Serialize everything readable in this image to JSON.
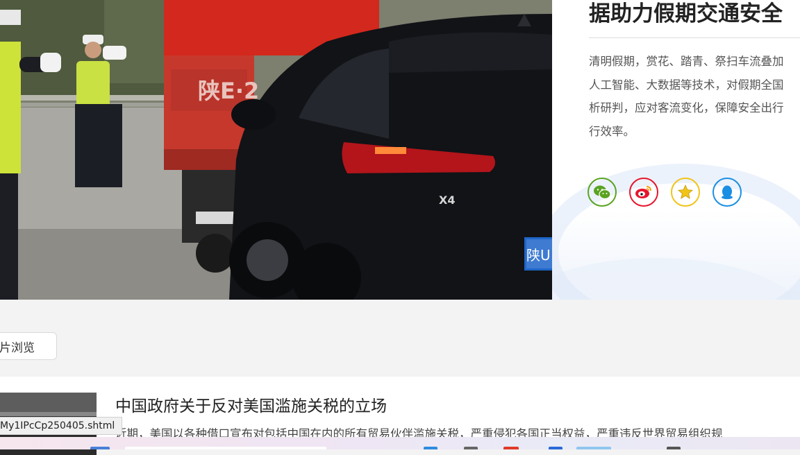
{
  "hero": {
    "photo_plate_text": "陕U",
    "photo_badge_text": "X4",
    "photo_truck_text": "陕E·2"
  },
  "side": {
    "title": "据助力假期交通安全",
    "body_lines": [
      "清明假期，赏花、踏青、祭扫车流叠加",
      "人工智能、大数据等技术，对假期全国",
      "析研判，应对客流变化，保障安全出行",
      "行效率。"
    ],
    "share_icons": [
      "wechat-icon",
      "weibo-icon",
      "favorite-star-icon",
      "qq-icon"
    ],
    "colors": {
      "wechat": "#5aa322",
      "weibo": "#e6162d",
      "favorite": "#f0c419",
      "qq": "#1a8fe3"
    }
  },
  "toolbar": {
    "browse_label": "片浏览"
  },
  "article": {
    "title": "中国政府关于反对美国滥施关税的立场",
    "snippet": "近期，美国以各种借口宣布对包括中国在内的所有贸易伙伴滥施关税，严重侵犯各国正当权益，严重违反世界贸易组织规"
  },
  "status_bar": {
    "url": "My1IPcCp250405.shtml"
  }
}
